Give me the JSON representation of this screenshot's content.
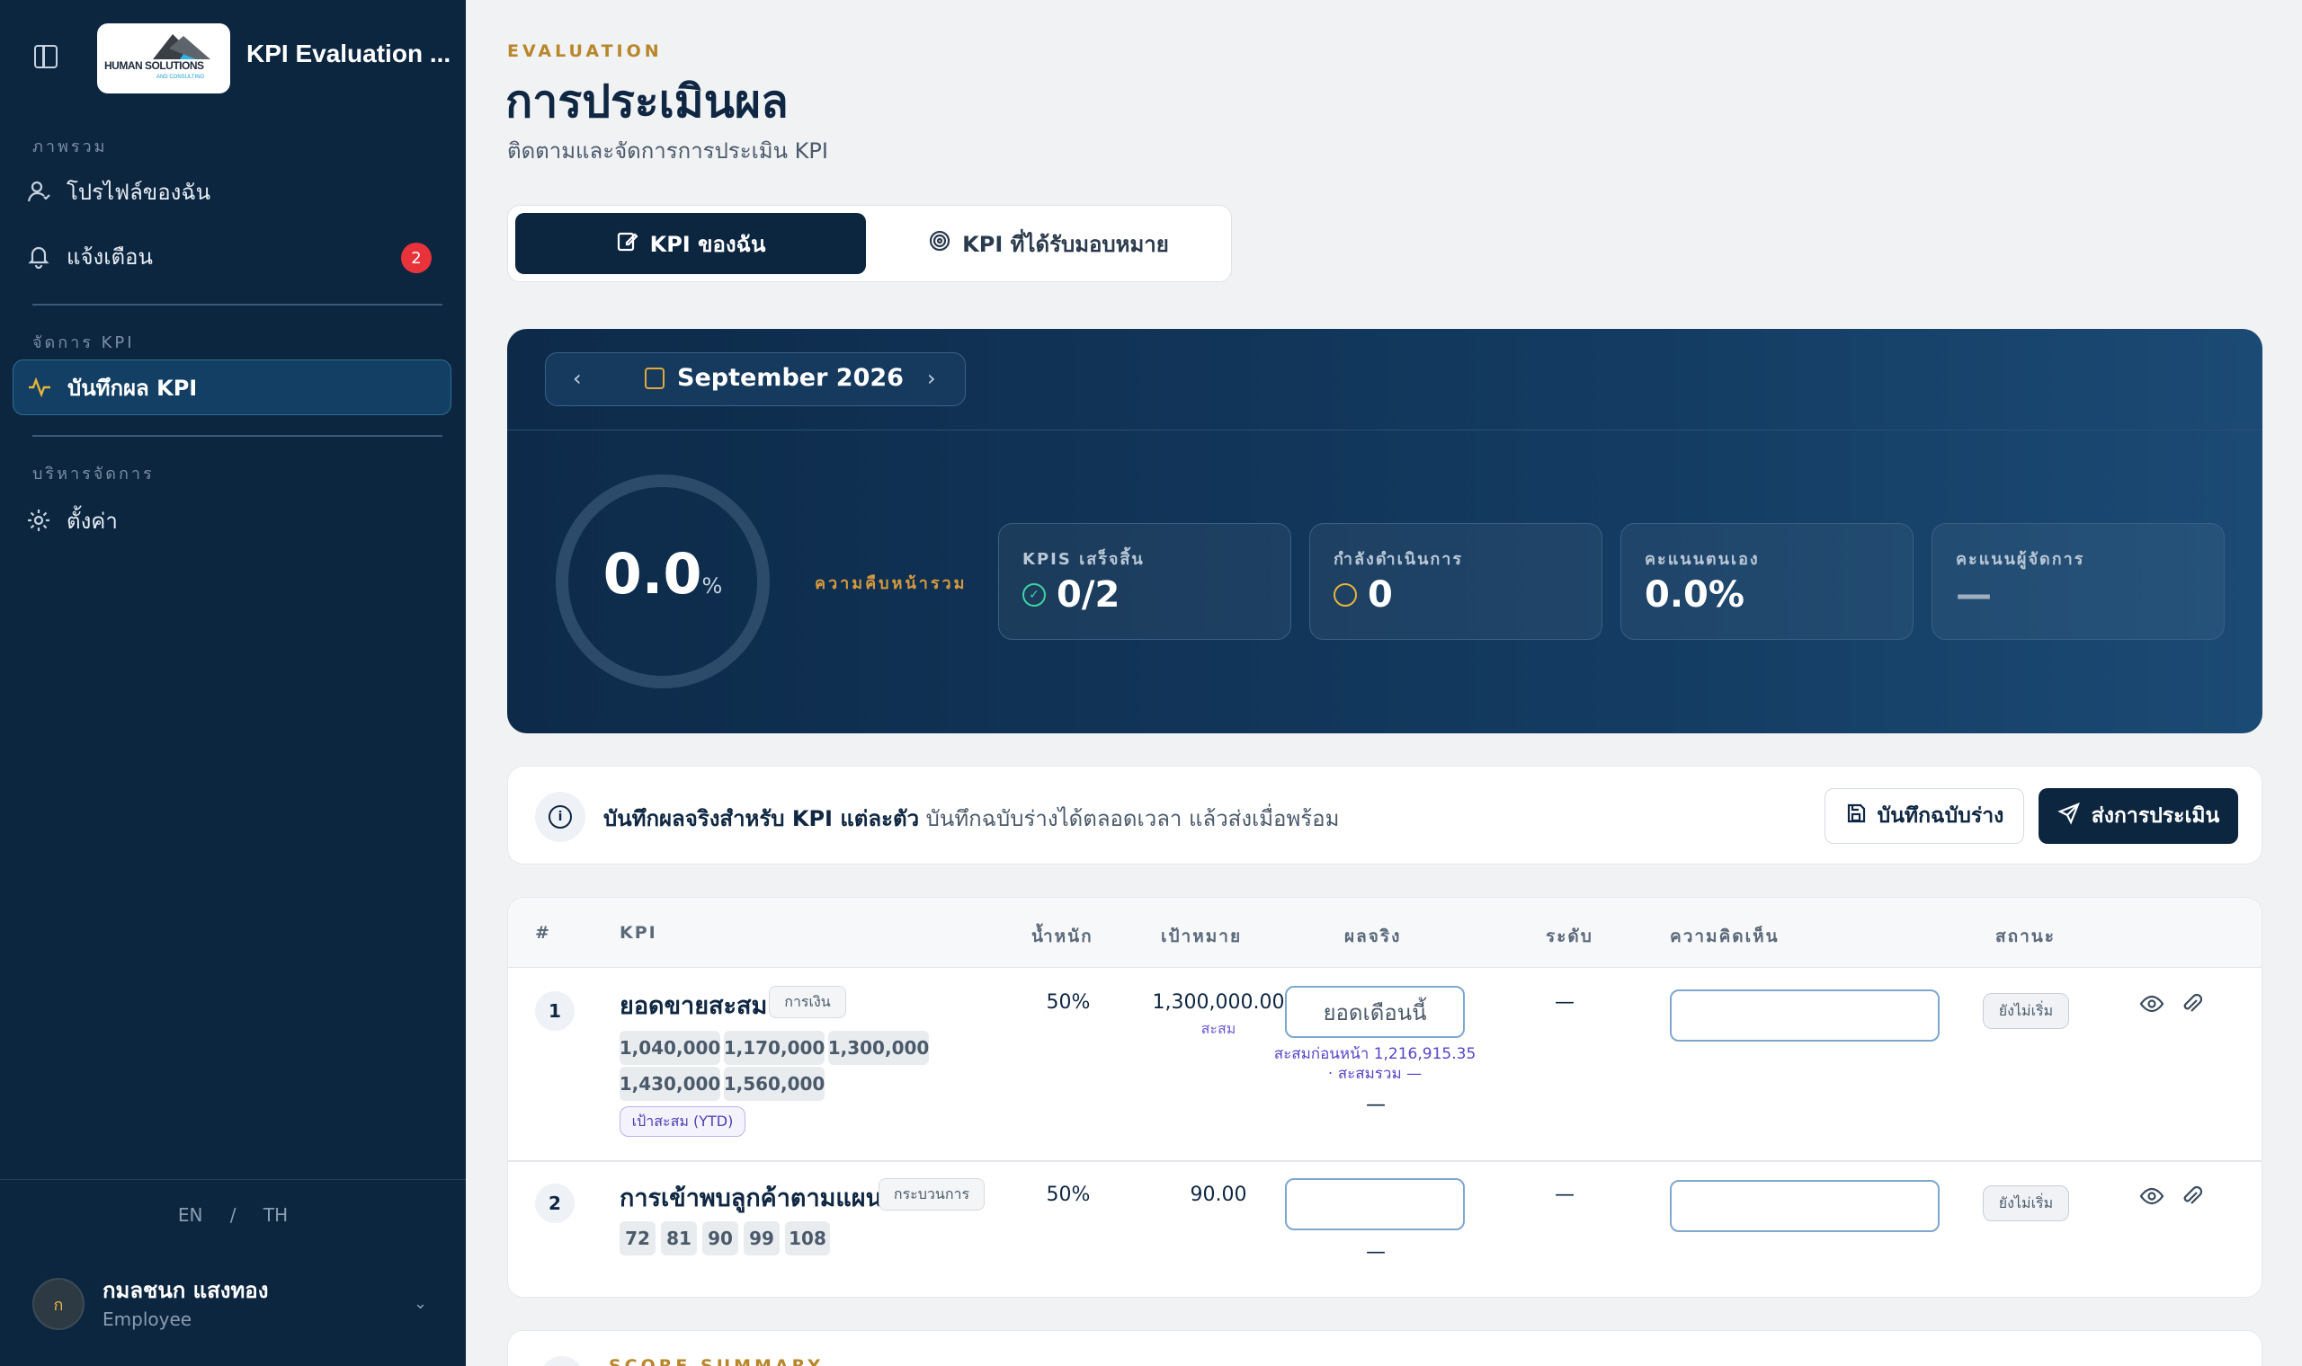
{
  "sidebar": {
    "app_title": "KPI Evaluation ...",
    "logo_text": "HUMAN SOLUTIONS",
    "logo_sub": "AND CONSULTING",
    "sections": [
      {
        "label": "ภาพรวม"
      },
      {
        "label": "จัดการ KPI"
      },
      {
        "label": "บริหารจัดการ"
      }
    ],
    "items": [
      {
        "label": "โปรไฟล์ของฉัน",
        "icon": "user-icon"
      },
      {
        "label": "แจ้งเตือน",
        "icon": "bell-icon",
        "badge": "2"
      },
      {
        "label": "บันทึกผล KPI",
        "icon": "activity-icon",
        "active": true
      },
      {
        "label": "ตั้งค่า",
        "icon": "gear-icon"
      }
    ],
    "lang": {
      "en": "EN",
      "sep": "/",
      "th": "TH"
    },
    "user": {
      "initial": "ก",
      "name": "กมลชนก แสงทอง",
      "role": "Employee"
    }
  },
  "header": {
    "eyebrow": "EVALUATION",
    "title": "การประเมินผล",
    "subtitle": "ติดตามและจัดการการประเมิน KPI"
  },
  "tabs": [
    {
      "label": "KPI ของฉัน",
      "active": true,
      "icon": "edit-icon"
    },
    {
      "label": "KPI ที่ได้รับมอบหมาย",
      "active": false,
      "icon": "target-icon"
    }
  ],
  "hero": {
    "month": "September 2026",
    "progress_value": "0.0",
    "progress_unit": "%",
    "progress_label": "ความคืบหน้ารวม",
    "stats": [
      {
        "label": "KPIS เสร็จสิ้น",
        "value": "0/2",
        "icon": "check-circle-icon",
        "color": "#3ed3a0"
      },
      {
        "label": "กำลังดำเนินการ",
        "value": "0",
        "icon": "clock-icon",
        "color": "#e6b53c"
      },
      {
        "label": "คะแนนตนเอง",
        "value": "0.0%"
      },
      {
        "label": "คะแนนผู้จัดการ",
        "value": "—"
      }
    ]
  },
  "info_bar": {
    "bold": "บันทึกผลจริงสำหรับ KPI แต่ละตัว",
    "text": " บันทึกฉบับร่างได้ตลอดเวลา แล้วส่งเมื่อพร้อม",
    "draft_button": "บันทึกฉบับร่าง",
    "submit_button": "ส่งการประเมิน"
  },
  "table": {
    "headers": {
      "num": "#",
      "kpi": "KPI",
      "weight": "น้ำหนัก",
      "target": "เป้าหมาย",
      "actual": "ผลจริง",
      "level": "ระดับ",
      "comment": "ความคิดเห็น",
      "status": "สถานะ"
    },
    "rows": [
      {
        "num": "1",
        "name": "ยอดขายสะสม",
        "category": "การเงิน",
        "levels": [
          "1,040,000",
          "1,170,000",
          "1,300,000",
          "1,430,000",
          "1,560,000"
        ],
        "ytd_tag": "เป้าสะสม (YTD)",
        "weight": "50%",
        "target": "1,300,000.00",
        "target_note": "สะสม",
        "actual_placeholder": "ยอดเดือนนี้",
        "actual_note1": "สะสมก่อนหน้า 1,216,915.35",
        "actual_note2": "· สะสมรวม —",
        "actual_dash": "—",
        "level": "—",
        "status": "ยังไม่เริ่ม"
      },
      {
        "num": "2",
        "name": "การเข้าพบลูกค้าตามแผน",
        "category": "กระบวนการ",
        "levels": [
          "72",
          "81",
          "90",
          "99",
          "108"
        ],
        "weight": "50%",
        "target": "90.00",
        "actual_placeholder": "",
        "actual_dash": "—",
        "level": "—",
        "status": "ยังไม่เริ่ม"
      }
    ]
  },
  "score_summary": {
    "label": "SCORE SUMMARY"
  }
}
